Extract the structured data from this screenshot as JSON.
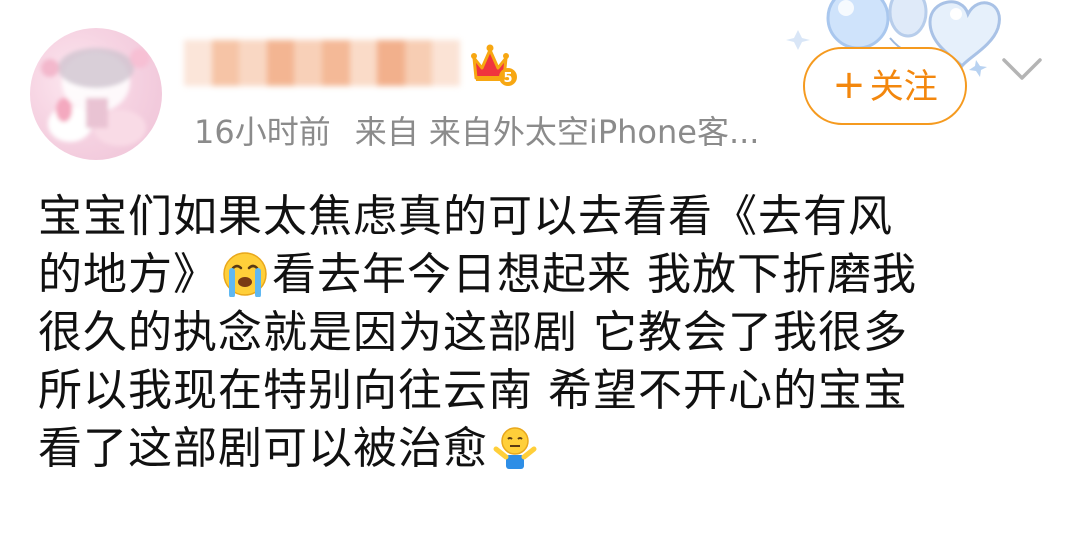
{
  "post": {
    "meta": {
      "time": "16小时前",
      "source_prefix": "来自",
      "source": "来自外太空iPhone客..."
    },
    "follow_button": {
      "plus": "+",
      "label": "关注"
    },
    "icons": {
      "crown": "crown-badge-icon",
      "badge_level": "5",
      "chevron": "chevron-down-icon",
      "emoji_crying": "loudly-crying-face-icon",
      "emoji_shrug": "shrug-person-icon"
    },
    "content": {
      "line1": "宝宝们如果太焦虑真的可以去看看《去有风",
      "line2_a": "的地方》",
      "line2_b": "看去年今日想起来 我放下折磨我",
      "line3": "很久的执念就是因为这部剧 它教会了我很多",
      "line4": "所以我现在特别向往云南 希望不开心的宝宝",
      "line5": "看了这部剧可以被治愈"
    },
    "colors": {
      "accent": "#f59a1f",
      "meta_text": "#8b8b8b",
      "body_text": "#111111"
    }
  }
}
